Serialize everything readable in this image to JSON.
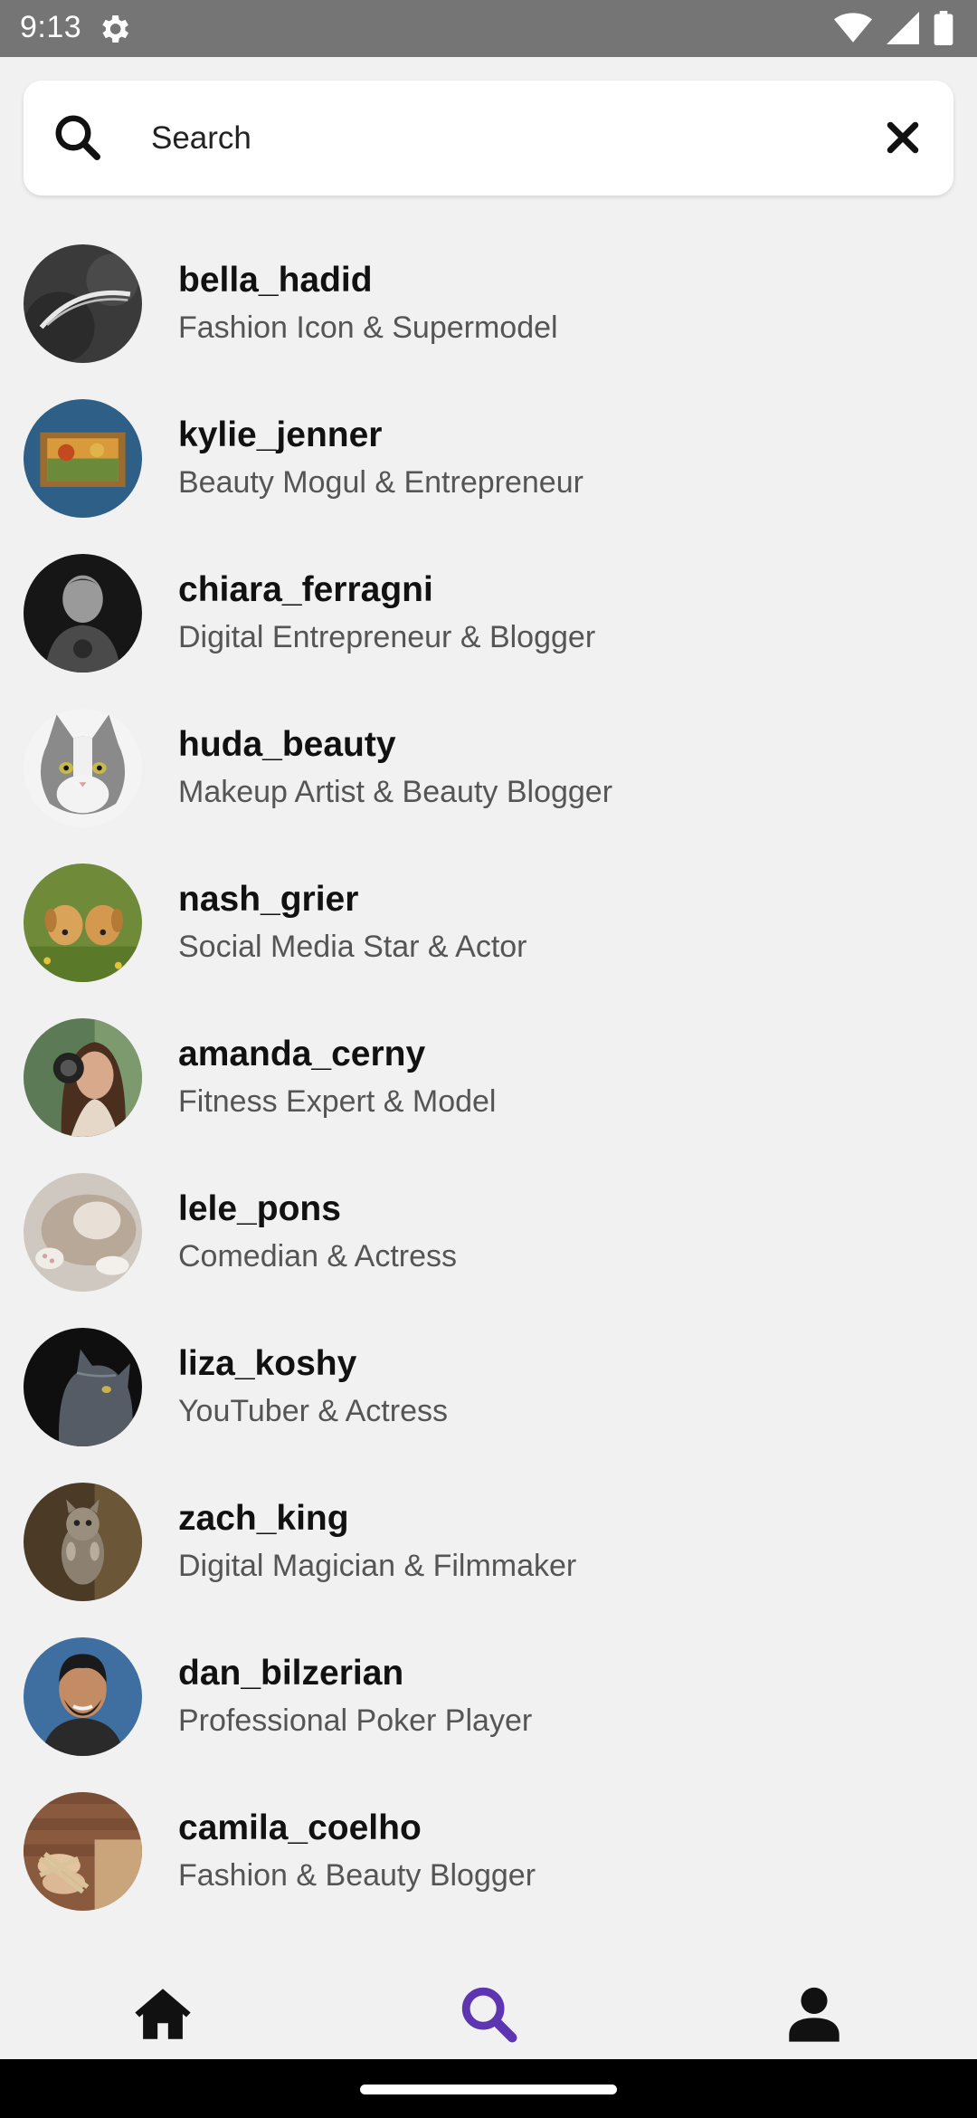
{
  "status_bar": {
    "time": "9:13"
  },
  "search": {
    "placeholder": "Search",
    "value": ""
  },
  "users": [
    {
      "username": "bella_hadid",
      "bio": "Fashion Icon & Supermodel"
    },
    {
      "username": "kylie_jenner",
      "bio": "Beauty Mogul & Entrepreneur"
    },
    {
      "username": "chiara_ferragni",
      "bio": "Digital Entrepreneur & Blogger"
    },
    {
      "username": "huda_beauty",
      "bio": "Makeup Artist & Beauty Blogger"
    },
    {
      "username": "nash_grier",
      "bio": "Social Media Star & Actor"
    },
    {
      "username": "amanda_cerny",
      "bio": "Fitness Expert & Model"
    },
    {
      "username": "lele_pons",
      "bio": "Comedian & Actress"
    },
    {
      "username": "liza_koshy",
      "bio": "YouTuber & Actress"
    },
    {
      "username": "zach_king",
      "bio": "Digital Magician & Filmmaker"
    },
    {
      "username": "dan_bilzerian",
      "bio": "Professional Poker Player"
    },
    {
      "username": "camila_coelho",
      "bio": "Fashion & Beauty Blogger"
    }
  ],
  "nav": {
    "items": [
      "home-icon",
      "search-icon",
      "profile-icon"
    ],
    "active": "search-icon",
    "active_color": "#5e35b1",
    "inactive_color": "#111111"
  }
}
